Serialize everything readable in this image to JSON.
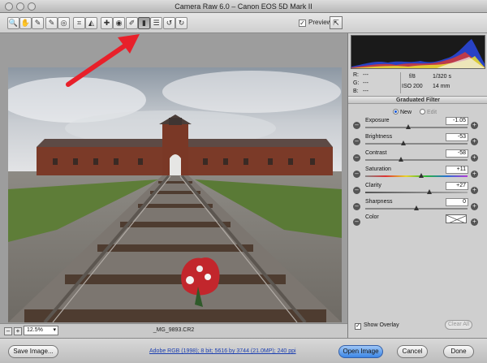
{
  "window": {
    "title": "Camera Raw 6.0  –  Canon EOS 5D Mark II"
  },
  "toolbar": {
    "tools": [
      {
        "name": "zoom-tool",
        "glyph": "🔍"
      },
      {
        "name": "hand-tool",
        "glyph": "✋"
      },
      {
        "name": "white-balance-tool",
        "glyph": "✎"
      },
      {
        "name": "color-sampler-tool",
        "glyph": "✎"
      },
      {
        "name": "targeted-adjustment-tool",
        "glyph": "◎"
      },
      {
        "name": "crop-tool",
        "glyph": "⌗"
      },
      {
        "name": "straighten-tool",
        "glyph": "◭"
      },
      {
        "name": "spot-removal-tool",
        "glyph": "✚"
      },
      {
        "name": "red-eye-tool",
        "glyph": "◉"
      },
      {
        "name": "adjustment-brush-tool",
        "glyph": "✐"
      },
      {
        "name": "graduated-filter-tool",
        "glyph": "▮"
      },
      {
        "name": "preferences-tool",
        "glyph": "☰"
      },
      {
        "name": "rotate-left-tool",
        "glyph": "↺"
      },
      {
        "name": "rotate-right-tool",
        "glyph": "↻"
      }
    ],
    "preview_label": "Preview",
    "preview_checked": "✓",
    "fullscreen_glyph": "⇱"
  },
  "status": {
    "zoom_minus": "–",
    "zoom_plus": "+",
    "zoom_level": "12.5%",
    "filename": "_MG_9893.CR2"
  },
  "info": {
    "r": "R:",
    "g": "G:",
    "b": "B:",
    "r_val": "---",
    "g_val": "---",
    "b_val": "---",
    "aperture": "f/8",
    "shutter": "1/320 s",
    "iso": "ISO 200",
    "focal": "14 mm"
  },
  "graduated_filter": {
    "header": "Graduated Filter",
    "mode_new": "New",
    "mode_edit": "Edit",
    "sliders": [
      {
        "label": "Exposure",
        "value": "-1.05",
        "position": 0.42
      },
      {
        "label": "Brightness",
        "value": "-53",
        "position": 0.37
      },
      {
        "label": "Contrast",
        "value": "-58",
        "position": 0.35
      },
      {
        "label": "Saturation",
        "value": "+11",
        "position": 0.55
      },
      {
        "label": "Clarity",
        "value": "+27",
        "position": 0.63
      },
      {
        "label": "Sharpness",
        "value": "0",
        "position": 0.5
      }
    ],
    "color_label": "Color",
    "show_overlay_label": "Show Overlay",
    "show_overlay_checked": "✓",
    "clear_all_label": "Clear All"
  },
  "footer": {
    "save_image": "Save Image...",
    "workflow": "Adobe RGB (1998); 8 bit; 5616 by 3744 (21.0MP); 240 ppi",
    "open_image": "Open Image",
    "cancel": "Cancel",
    "done": "Done"
  },
  "colors": {
    "accent": "#3b86e6",
    "arrow": "#e8202a"
  }
}
